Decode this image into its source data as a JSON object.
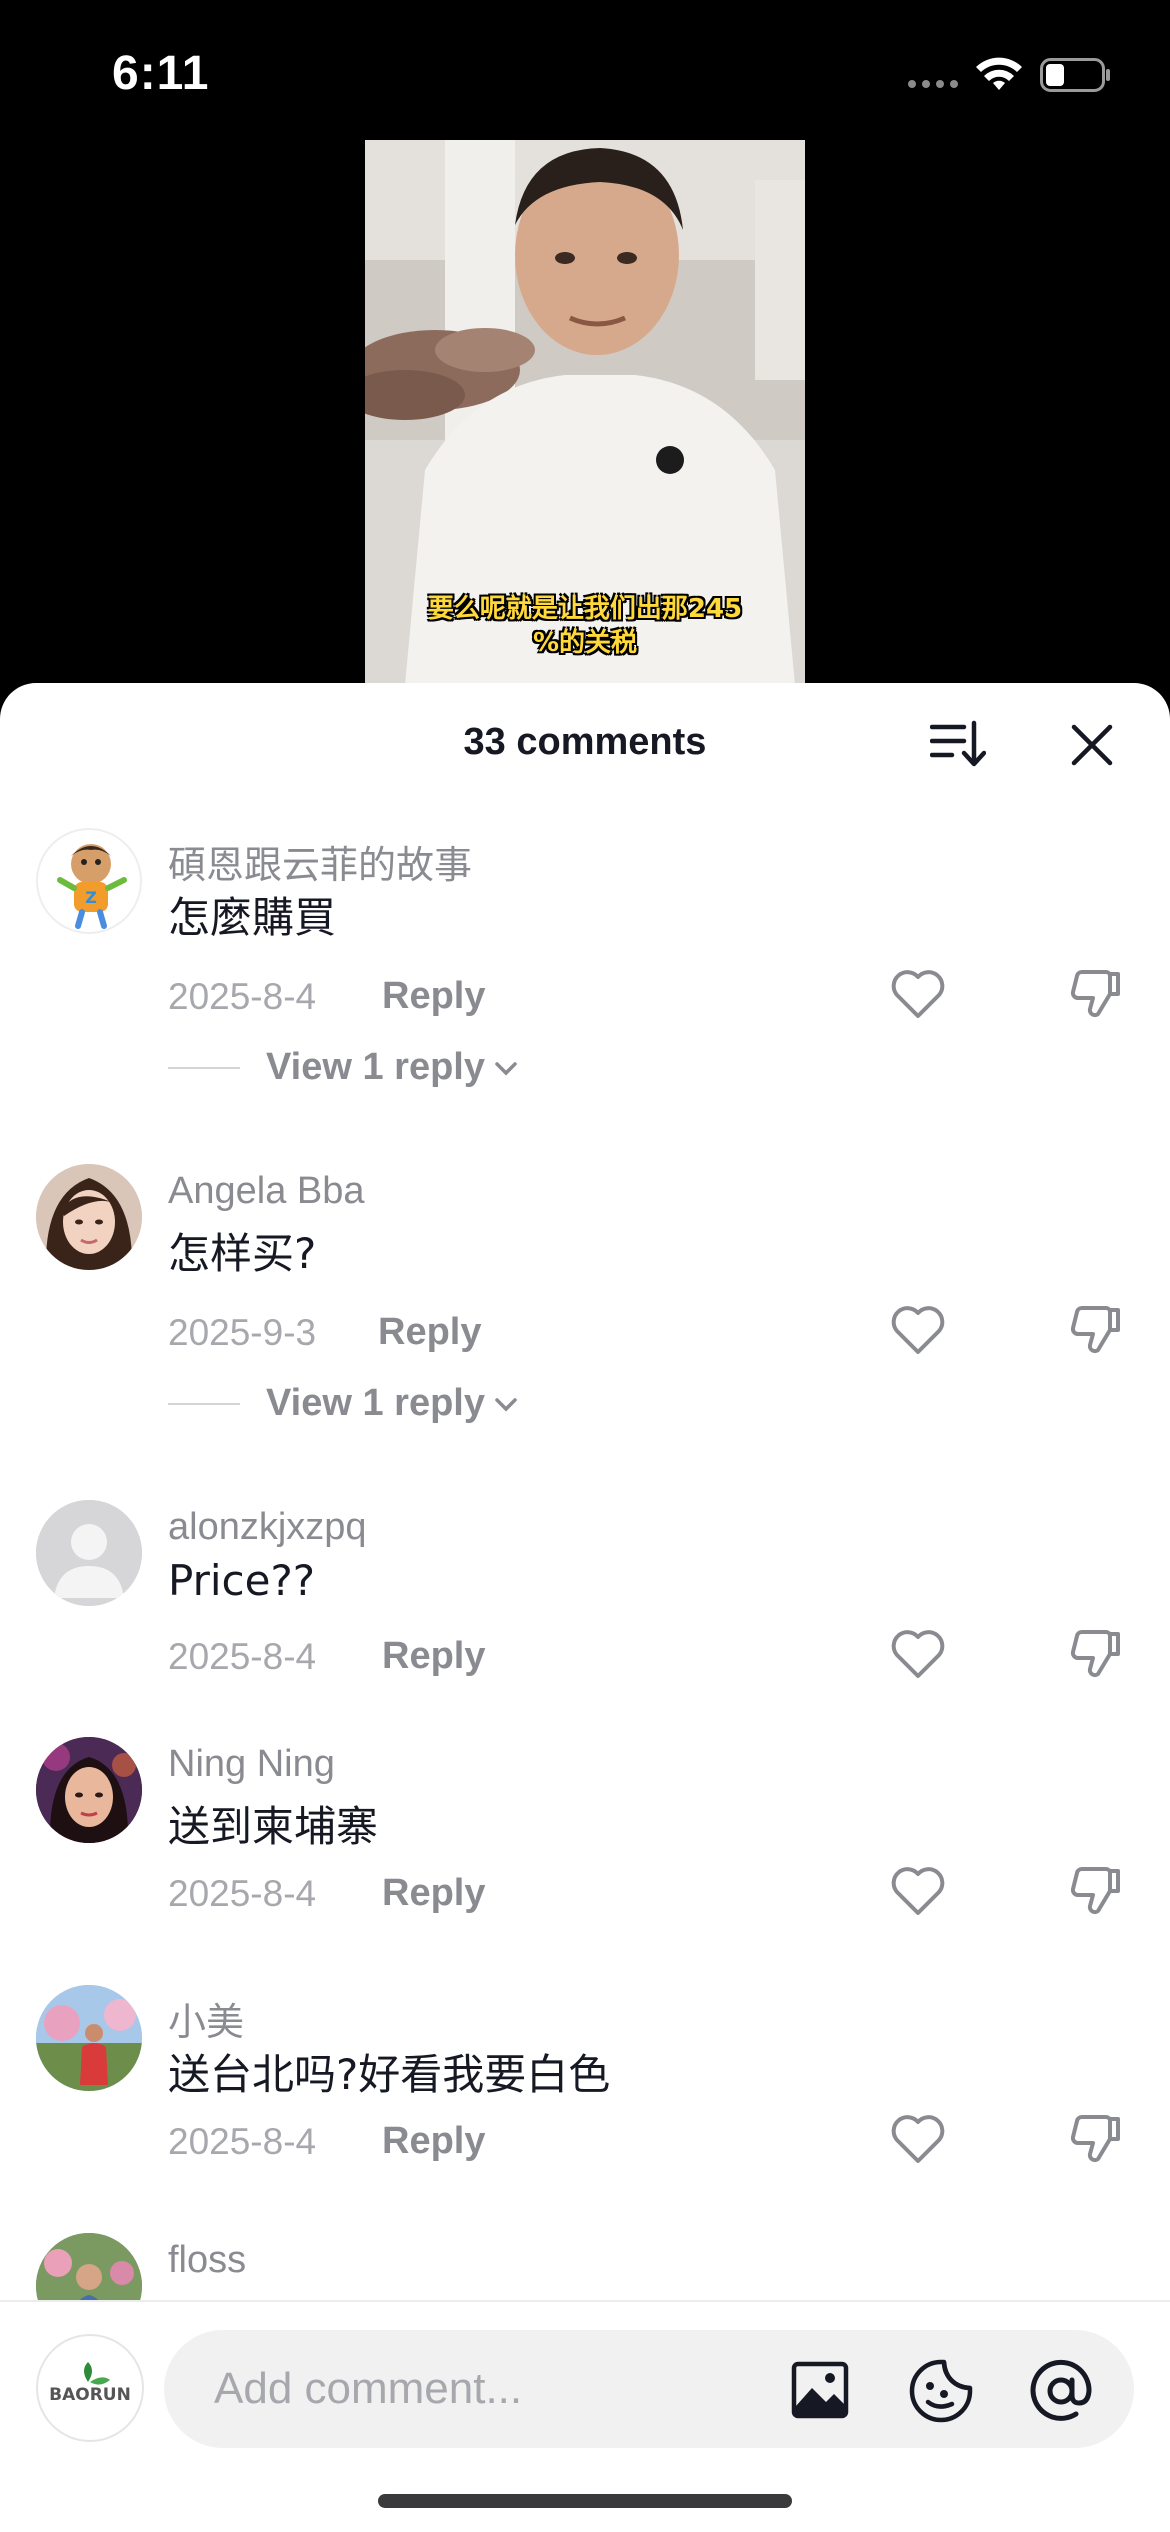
{
  "status_bar": {
    "time": "6:11"
  },
  "video": {
    "caption_line1": "要么呢就是让我们出那245",
    "caption_line2": "%的关税"
  },
  "sheet": {
    "comment_count_label": "33 comments"
  },
  "comments": [
    {
      "username": "碩恩跟云菲的故事",
      "text": "怎麼購買",
      "date": "2025-8-4",
      "reply_label": "Reply",
      "view_replies_label": "View 1 reply"
    },
    {
      "username": "Angela Bba",
      "text": "怎样买?",
      "date": "2025-9-3",
      "reply_label": "Reply",
      "view_replies_label": "View 1 reply"
    },
    {
      "username": "alonzkjxzpq",
      "text": "Price??",
      "date": "2025-8-4",
      "reply_label": "Reply"
    },
    {
      "username": "Ning Ning",
      "text": "送到柬埔寨",
      "date": "2025-8-4",
      "reply_label": "Reply"
    },
    {
      "username": "小美",
      "text": "送台北吗?好看我要白色",
      "date": "2025-8-4",
      "reply_label": "Reply"
    },
    {
      "username": "floss"
    }
  ],
  "composer": {
    "placeholder": "Add comment...",
    "avatar_logo_text": "BAORUN"
  },
  "icons": {
    "sort": "sort-icon",
    "close": "close-icon",
    "like": "heart-icon",
    "dislike": "thumbs-down-icon",
    "image": "image-icon",
    "sticker": "sticker-icon",
    "mention": "at-mention-icon"
  },
  "colors": {
    "sheet_bg": "#ffffff",
    "muted_text": "#8a8b91",
    "primary_text": "#161823",
    "caption": "#ffd93b"
  }
}
